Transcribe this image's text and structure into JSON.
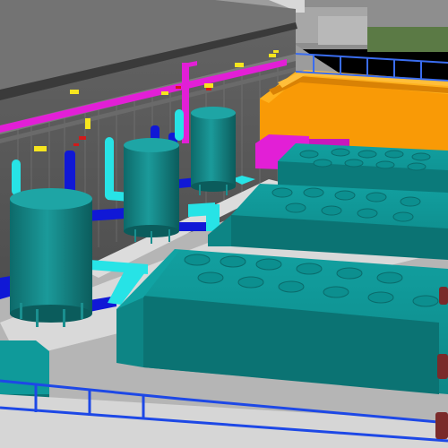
{
  "scene": {
    "view": "3d-plant-model",
    "components": [
      "building-wall",
      "storage-tank",
      "generator-set",
      "piping",
      "cable-tray",
      "fence",
      "roof-structure"
    ]
  },
  "colors": {
    "background": "#000000",
    "wall": "#5a5a5a",
    "ceiling": "#6e6e6e",
    "floor": "#9c9c9c",
    "slab": "#e6e6e6",
    "tank": "#1a9494",
    "tank_dark": "#0d6a6a",
    "generator": "#0f9a9a",
    "generator_dark": "#0b7373",
    "pipe_cyan": "#27e3e6",
    "pipe_blue": "#1018d6",
    "pipe_magenta": "#e21fd6",
    "orange": "#f99a06",
    "orange_dark": "#c47706",
    "marker_yellow": "#f6e51e",
    "marker_red": "#d21a1a",
    "fence": "#1d48e6",
    "bolt_red": "#7a2a2a"
  }
}
